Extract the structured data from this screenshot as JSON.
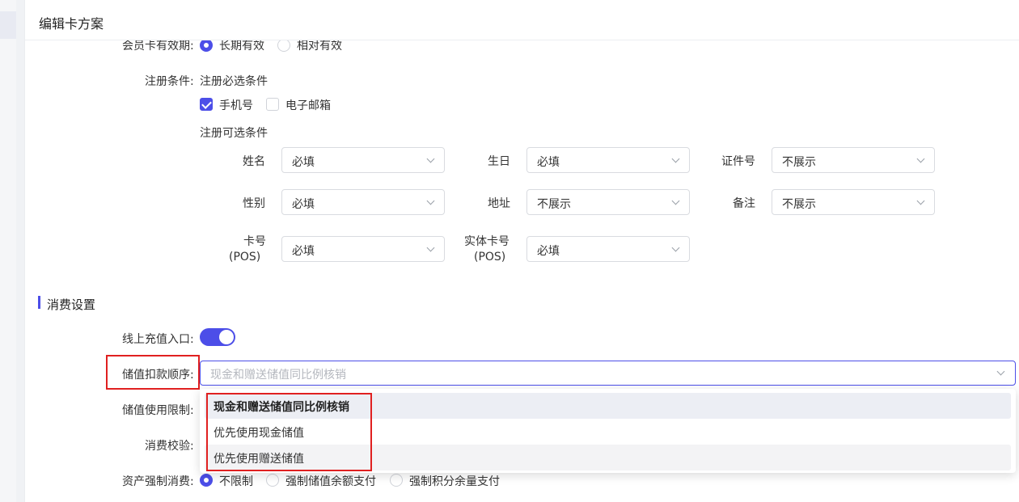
{
  "header": {
    "title": "编辑卡方案"
  },
  "validity": {
    "label": "会员卡有效期:",
    "options": [
      "长期有效",
      "相对有效"
    ],
    "selected": "长期有效"
  },
  "register": {
    "label": "注册条件:",
    "required_title": "注册必选条件",
    "required_items": [
      {
        "label": "手机号",
        "checked": true
      },
      {
        "label": "电子邮箱",
        "checked": false
      }
    ],
    "optional_title": "注册可选条件",
    "fields": [
      {
        "label": "姓名",
        "value": "必填"
      },
      {
        "label": "生日",
        "value": "必填"
      },
      {
        "label": "证件号",
        "value": "不展示"
      },
      {
        "label": "性别",
        "value": "必填"
      },
      {
        "label": "地址",
        "value": "不展示"
      },
      {
        "label": "备注",
        "value": "不展示"
      },
      {
        "label": "卡号",
        "sub": "(POS)",
        "value": "必填"
      },
      {
        "label": "实体卡号",
        "sub": "(POS)",
        "value": "必填"
      }
    ]
  },
  "consume": {
    "section_title": "消费设置",
    "recharge_label": "线上充值入口:",
    "recharge_enabled": true,
    "deduct_label": "储值扣款顺序:",
    "deduct_placeholder": "现金和赠送储值同比例核销",
    "deduct_options": [
      "现金和赠送储值同比例核销",
      "优先使用现金储值",
      "优先使用赠送储值"
    ],
    "deduct_selected": "现金和赠送储值同比例核销",
    "limit_label": "储值使用限制:",
    "verify_label": "消费校验:",
    "force_label": "资产强制消费:",
    "force_options": [
      "不限制",
      "强制储值余额支付",
      "强制积分余量支付"
    ],
    "force_selected": "不限制"
  },
  "colors": {
    "accent": "#4c4ee8",
    "highlight": "#e02020"
  }
}
